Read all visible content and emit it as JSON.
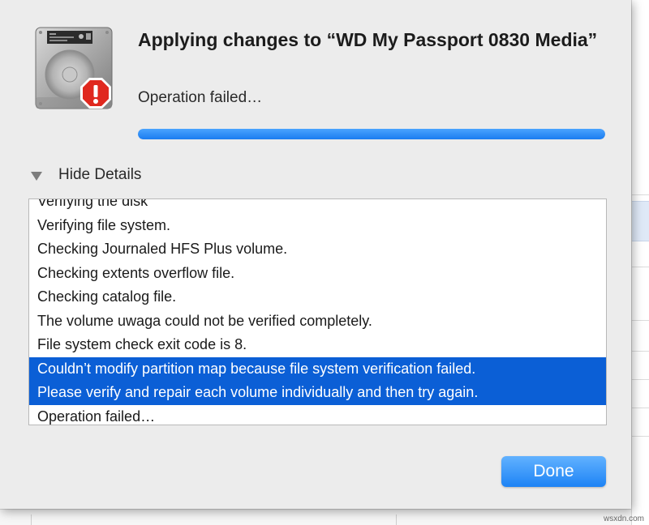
{
  "dialog": {
    "title": "Applying changes to “WD My Passport 0830 Media”",
    "status": "Operation failed…",
    "progress_percent": 100,
    "details_toggle_label": "Hide Details",
    "done_label": "Done"
  },
  "log": {
    "lines": [
      {
        "text": "Verifying the disk",
        "selected": false
      },
      {
        "text": "Verifying file system.",
        "selected": false
      },
      {
        "text": "Checking Journaled HFS Plus volume.",
        "selected": false
      },
      {
        "text": "Checking extents overflow file.",
        "selected": false
      },
      {
        "text": "Checking catalog file.",
        "selected": false
      },
      {
        "text": "The volume uwaga could not be verified completely.",
        "selected": false
      },
      {
        "text": "File system check exit code is 8.",
        "selected": false
      },
      {
        "text": "Couldn’t modify partition map because file system verification failed.",
        "selected": true
      },
      {
        "text": "Please verify and repair each volume individually and then try again.",
        "selected": true
      },
      {
        "text": "Operation failed…",
        "selected": false
      }
    ]
  },
  "icons": {
    "drive": "hard-drive-icon",
    "warning": "error-badge-icon",
    "disclosure": "disclosure-triangle-down-icon"
  },
  "colors": {
    "accent": "#1d83f5",
    "selection": "#0b5fd6",
    "error": "#e0281e"
  },
  "watermark": "wsxdn.com"
}
